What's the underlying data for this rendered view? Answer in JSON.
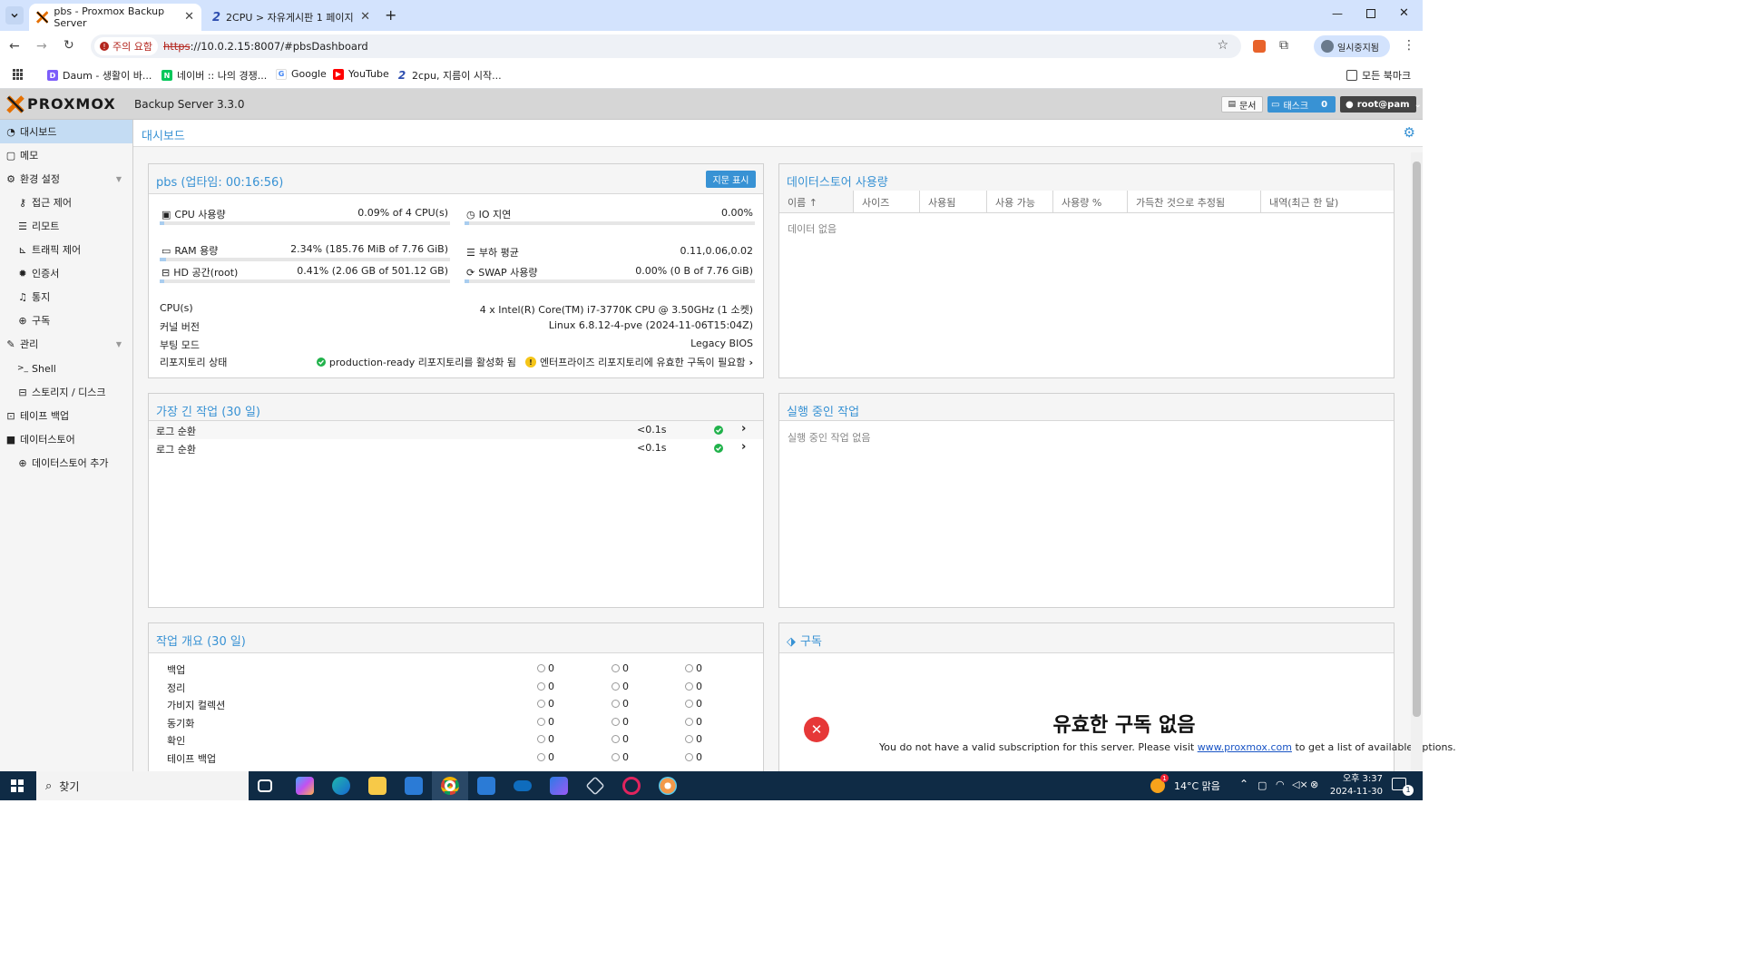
{
  "browser": {
    "tabs": [
      {
        "title": "pbs - Proxmox Backup Server",
        "active": true
      },
      {
        "title": "2CPU > 자유게시판 1 페이지",
        "active": false
      }
    ],
    "security_label": "주의 요함",
    "url_scheme": "https",
    "url_rest": "://10.0.2.15:8007/#pbsDashboard",
    "profile_label": "일시중지됨",
    "bookmarks": [
      "Daum - 생활이 바...",
      "네이버 :: 나의 경쟁...",
      "Google",
      "YouTube",
      "2cpu, 지름이 시작..."
    ],
    "all_bookmarks": "모든 북마크"
  },
  "app": {
    "logo": "PROXMOX",
    "product": "Backup Server 3.3.0",
    "docs_label": "문서",
    "tasks_label": "태스크",
    "tasks_count": "0",
    "user_label": "root@pam"
  },
  "sidebar": {
    "items": [
      {
        "label": "대시보드",
        "icon": "dashboard-icon"
      },
      {
        "label": "메모",
        "icon": "notes-icon"
      },
      {
        "label": "환경 설정",
        "icon": "gears-icon"
      },
      {
        "label": "접근 제어",
        "icon": "key-icon"
      },
      {
        "label": "리모트",
        "icon": "server-icon"
      },
      {
        "label": "트래픽 제어",
        "icon": "signal-icon"
      },
      {
        "label": "인증서",
        "icon": "certificate-icon"
      },
      {
        "label": "통지",
        "icon": "bell-icon"
      },
      {
        "label": "구독",
        "icon": "support-icon"
      },
      {
        "label": "관리",
        "icon": "wrench-icon"
      },
      {
        "label": "Shell",
        "icon": "terminal-icon"
      },
      {
        "label": "스토리지 / 디스크",
        "icon": "disk-icon"
      },
      {
        "label": "테이프 백업",
        "icon": "tape-icon"
      },
      {
        "label": "데이터스토어",
        "icon": "archive-icon"
      },
      {
        "label": "데이터스토어 추가",
        "icon": "plus-circle-icon"
      }
    ]
  },
  "content": {
    "title": "대시보드",
    "status": {
      "title": "pbs (업타임: 00:16:56)",
      "fingerprint_button": "지문 표시",
      "cpu_label": "CPU 사용량",
      "cpu_value": "0.09% of 4 CPU(s)",
      "cpu_fraction": 0.0009,
      "io_label": "IO 지연",
      "io_value": "0.00%",
      "io_fraction": 0,
      "ram_label": "RAM 용량",
      "ram_value": "2.34% (185.76 MiB of 7.76 GiB)",
      "ram_fraction": 0.0234,
      "load_label": "부하 평균",
      "load_value": "0.11,0.06,0.02",
      "hd_label": "HD 공간(root)",
      "hd_value": "0.41% (2.06 GB of 501.12 GB)",
      "hd_fraction": 0.0041,
      "swap_label": "SWAP 사용량",
      "swap_value": "0.00% (0 B of 7.76 GiB)",
      "swap_fraction": 0,
      "cpus_label": "CPU(s)",
      "cpus_value": "4 x Intel(R) Core(TM) i7-3770K CPU @ 3.50GHz (1 소켓)",
      "kernel_label": "커널 버전",
      "kernel_value": "Linux 6.8.12-4-pve (2024-11-06T15:04Z)",
      "boot_label": "부팅 모드",
      "boot_value": "Legacy BIOS",
      "repo_label": "리포지토리 상태",
      "repo_ok": "production-ready 리포지토리를 활성화 됨",
      "repo_warn": "엔터프라이즈 리포지토리에 유효한 구독이 필요함"
    },
    "datastore_usage": {
      "title": "데이터스토어 사용량",
      "columns": [
        "이름 ↑",
        "사이즈",
        "사용됨",
        "사용 가능",
        "사용량 %",
        "가득찬 것으로 추정됨",
        "내역(최근 한 달)"
      ],
      "empty": "데이터 없음"
    },
    "longest_tasks": {
      "title": "가장 긴 작업 (30 일)",
      "rows": [
        {
          "name": "로그 순환",
          "duration": "<0.1s"
        },
        {
          "name": "로그 순환",
          "duration": "<0.1s"
        }
      ]
    },
    "running_tasks": {
      "title": "실행 중인 작업",
      "empty": "실행 중인 작업 없음"
    },
    "task_summary": {
      "title": "작업 개요 (30 일)",
      "rows": [
        {
          "name": "백업",
          "ok": "0",
          "warn": "0",
          "err": "0"
        },
        {
          "name": "정리",
          "ok": "0",
          "warn": "0",
          "err": "0"
        },
        {
          "name": "가비지 컬렉션",
          "ok": "0",
          "warn": "0",
          "err": "0"
        },
        {
          "name": "동기화",
          "ok": "0",
          "warn": "0",
          "err": "0"
        },
        {
          "name": "확인",
          "ok": "0",
          "warn": "0",
          "err": "0"
        },
        {
          "name": "테이프 백업",
          "ok": "0",
          "warn": "0",
          "err": "0"
        }
      ]
    },
    "subscription": {
      "title": "구독",
      "heading": "유효한 구독 없음",
      "text_before": "You do not have a valid subscription for this server. Please visit",
      "link": "www.proxmox.com",
      "text_after": "to get a list of available options."
    }
  },
  "taskbar": {
    "search_label": "찾기",
    "weather": "14°C  맑음",
    "weather_badge": "1",
    "time": "오후 3:37",
    "date": "2024-11-30",
    "notification_count": "1"
  }
}
